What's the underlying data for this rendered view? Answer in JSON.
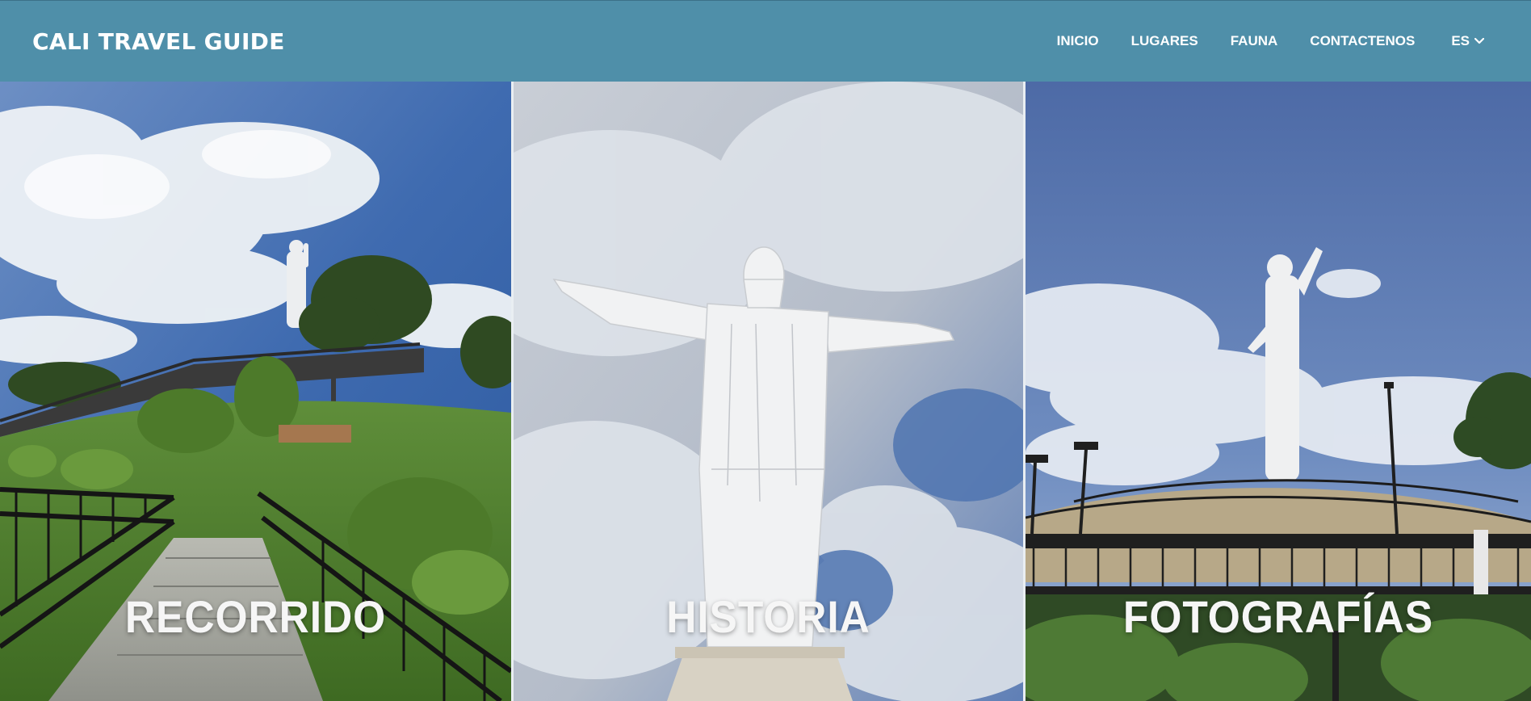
{
  "header": {
    "brand": "CALI TRAVEL GUIDE",
    "nav": [
      {
        "label": "INICIO"
      },
      {
        "label": "LUGARES"
      },
      {
        "label": "FAUNA"
      },
      {
        "label": "CONTACTENOS"
      }
    ],
    "language": {
      "selected": "ES",
      "icon": "chevron-down-icon"
    }
  },
  "panels": [
    {
      "title": "RECORRIDO"
    },
    {
      "title": "HISTORIA"
    },
    {
      "title": "FOTOGRAFÍAS"
    }
  ],
  "colors": {
    "navbar": "#4f8fa9",
    "text": "#ffffff"
  }
}
